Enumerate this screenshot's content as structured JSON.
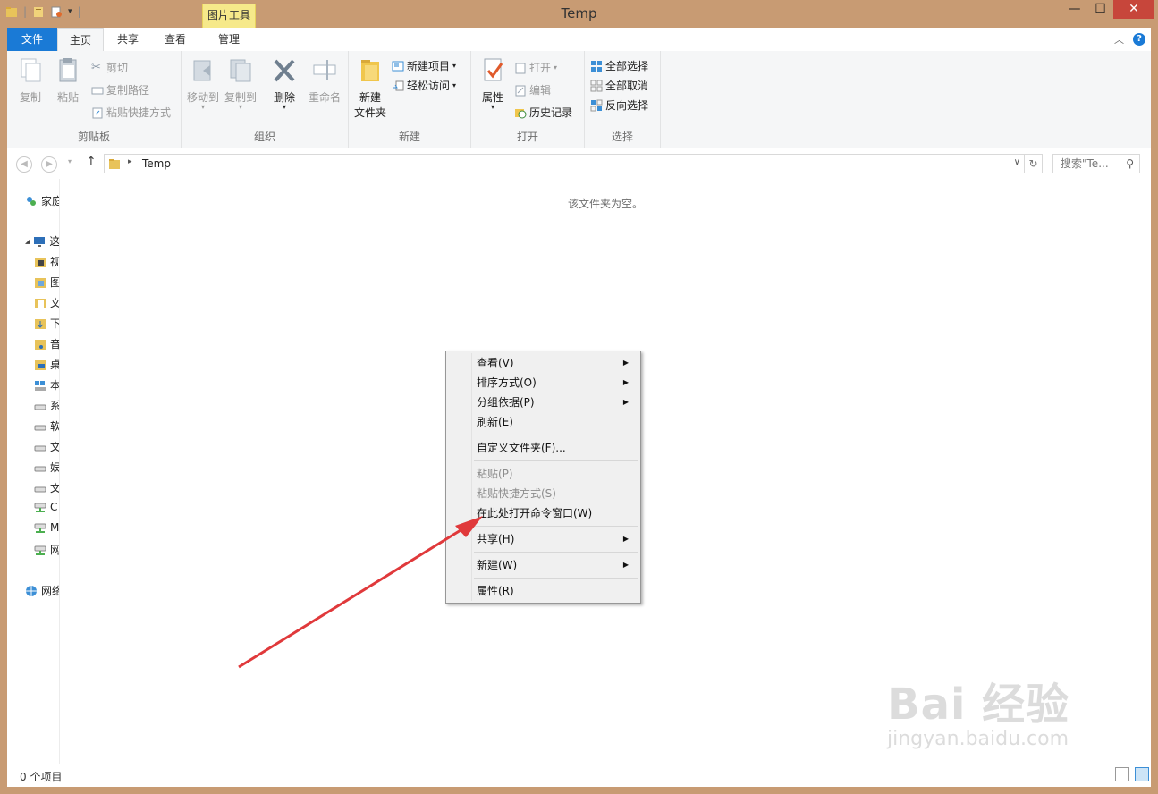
{
  "window": {
    "title": "Temp",
    "contextual_tab": "图片工具",
    "controls": {
      "minimize": "—",
      "maximize": "☐",
      "close": "✕"
    }
  },
  "ribbon_tabs": [
    {
      "label": "文件"
    },
    {
      "label": "主页"
    },
    {
      "label": "共享"
    },
    {
      "label": "查看"
    },
    {
      "label": "管理"
    }
  ],
  "ribbon": {
    "clipboard": {
      "copy": "复制",
      "paste": "粘贴",
      "cut": "剪切",
      "copy_path": "复制路径",
      "paste_shortcut": "粘贴快捷方式",
      "label": "剪贴板"
    },
    "organize": {
      "move_to": "移动到",
      "copy_to": "复制到",
      "delete": "删除",
      "rename": "重命名",
      "label": "组织"
    },
    "new": {
      "new_folder_line1": "新建",
      "new_folder_line2": "文件夹",
      "new_item": "新建项目",
      "easy_access": "轻松访问",
      "label": "新建"
    },
    "open": {
      "properties": "属性",
      "open": "打开",
      "edit": "编辑",
      "history": "历史记录",
      "label": "打开"
    },
    "select": {
      "select_all": "全部选择",
      "select_none": "全部取消",
      "invert": "反向选择",
      "label": "选择"
    }
  },
  "address": {
    "path": "Temp",
    "search_placeholder": "搜索\"Te..."
  },
  "nav_pane": {
    "homegroup": "家庭",
    "this_pc": "这台",
    "items": [
      "视",
      "图",
      "文",
      "下",
      "音",
      "桌",
      "本",
      "系",
      "软",
      "文",
      "娱",
      "文",
      "C",
      "M",
      "网"
    ],
    "network": "网络"
  },
  "content": {
    "empty_text": "该文件夹为空。"
  },
  "status": {
    "item_count": "0 个项目"
  },
  "context_menu": {
    "items": [
      {
        "label": "查看(V)",
        "submenu": true,
        "disabled": false
      },
      {
        "label": "排序方式(O)",
        "submenu": true,
        "disabled": false
      },
      {
        "label": "分组依据(P)",
        "submenu": true,
        "disabled": false
      },
      {
        "label": "刷新(E)",
        "submenu": false,
        "disabled": false
      },
      {
        "label": "自定义文件夹(F)...",
        "submenu": false,
        "disabled": false
      },
      {
        "label": "粘贴(P)",
        "submenu": false,
        "disabled": true
      },
      {
        "label": "粘贴快捷方式(S)",
        "submenu": false,
        "disabled": true
      },
      {
        "label": "在此处打开命令窗口(W)",
        "submenu": false,
        "disabled": false
      },
      {
        "label": "共享(H)",
        "submenu": true,
        "disabled": false
      },
      {
        "label": "新建(W)",
        "submenu": true,
        "disabled": false
      },
      {
        "label": "属性(R)",
        "submenu": false,
        "disabled": false
      }
    ]
  },
  "watermark": {
    "line1": "Bai 经验",
    "line2": "jingyan.baidu.com"
  },
  "colors": {
    "accent": "#1a7ad6",
    "frame": "#c89b73",
    "contextual_tab": "#f6e98a",
    "arrow": "#e0393b"
  }
}
